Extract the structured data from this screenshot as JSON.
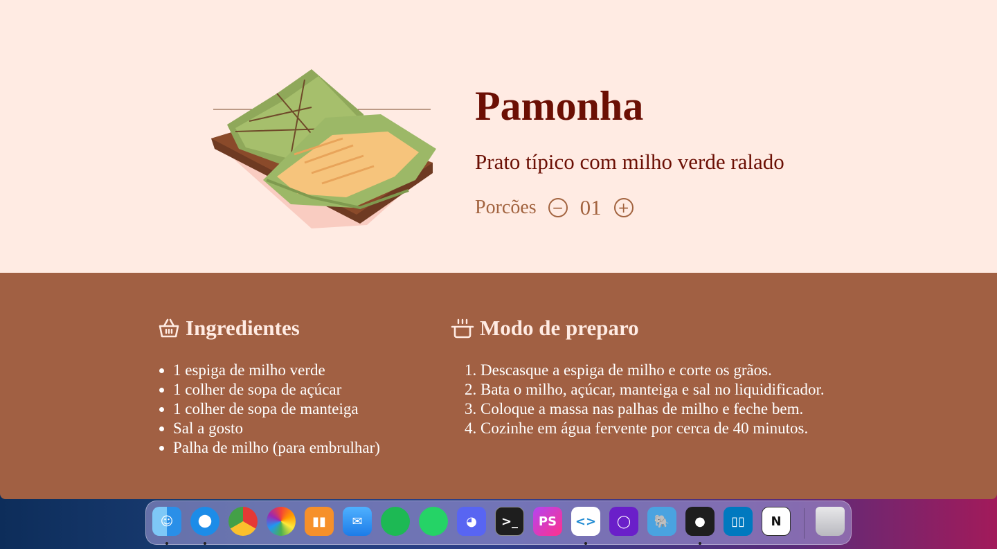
{
  "recipe": {
    "title": "Pamonha",
    "subtitle": "Prato típico com milho verde ralado",
    "servings_label": "Porcões",
    "servings_value": "01",
    "decrement_symbol": "−",
    "increment_symbol": "+"
  },
  "ingredients": {
    "title": "Ingredientes",
    "icon": "basket-icon",
    "items": [
      "1 espiga de milho verde",
      "1 colher de sopa de açúcar",
      "1 colher de sopa de manteiga",
      "Sal a gosto",
      "Palha de milho (para embrulhar)"
    ]
  },
  "preparation": {
    "title": "Modo de preparo",
    "icon": "cooking-pot-icon",
    "steps": [
      "Descasque a espiga de milho e corte os grãos.",
      "Bata o milho, açúcar, manteiga e sal no liquidificador.",
      "Coloque a massa nas palhas de milho e feche bem.",
      "Cozinhe em água fervente por cerca de 40 minutos."
    ]
  },
  "colors": {
    "hero_background": "#ffebe3",
    "recipe_background": "#a16043",
    "title_color": "#6b0f04",
    "muted_color": "#a2633f"
  },
  "dock": {
    "apps": [
      {
        "name": "Finder",
        "icon": "finder-icon",
        "running": true
      },
      {
        "name": "Safari",
        "icon": "safari-icon",
        "running": true
      },
      {
        "name": "Chrome",
        "icon": "chrome-icon",
        "running": false
      },
      {
        "name": "Photos",
        "icon": "photos-icon",
        "running": false
      },
      {
        "name": "Books",
        "icon": "books-icon",
        "running": false
      },
      {
        "name": "Mail",
        "icon": "mail-icon",
        "running": false
      },
      {
        "name": "Spotify",
        "icon": "spotify-icon",
        "running": false
      },
      {
        "name": "WhatsApp",
        "icon": "whatsapp-icon",
        "running": false
      },
      {
        "name": "Discord",
        "icon": "discord-icon",
        "running": false
      },
      {
        "name": "Terminal",
        "icon": "terminal-icon",
        "running": false
      },
      {
        "name": "PhpStorm",
        "icon": "phpstorm-icon",
        "running": false
      },
      {
        "name": "VS Code",
        "icon": "vscode-icon",
        "running": true
      },
      {
        "name": "Podcast",
        "icon": "podcast-icon",
        "running": false
      },
      {
        "name": "TablePlus",
        "icon": "elephant-icon",
        "running": false
      },
      {
        "name": "Figma",
        "icon": "figma-icon",
        "running": true
      },
      {
        "name": "Trello",
        "icon": "trello-icon",
        "running": false
      },
      {
        "name": "Notion",
        "icon": "notion-icon",
        "running": false
      },
      {
        "name": "Trash",
        "icon": "trash-icon",
        "running": false
      }
    ]
  }
}
